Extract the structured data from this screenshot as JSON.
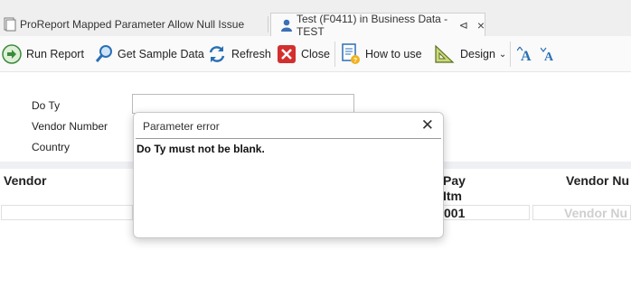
{
  "tabs": [
    {
      "label": "ProReport Mapped Parameter Allow Null Issue",
      "active": false
    },
    {
      "label": "Test (F0411) in Business Data - TEST",
      "active": true
    }
  ],
  "toolbar": {
    "run_report": "Run Report",
    "get_sample_data": "Get Sample Data",
    "refresh": "Refresh",
    "close": "Close",
    "how_to_use": "How to use",
    "design": "Design"
  },
  "form": {
    "do_ty_label": "Do Ty",
    "vendor_number_label": "Vendor Number",
    "country_label": "Country",
    "do_ty_value": ""
  },
  "grid": {
    "headers": [
      "Vendor",
      "Pay",
      "Itm",
      "Vendor Nu"
    ],
    "row": {
      "pay_item": "001",
      "vendor_placeholder": "Vendor Nu"
    }
  },
  "dialog": {
    "title": "Parameter error",
    "message": "Do Ty must not be blank."
  },
  "colors": {
    "accent": "#2e7d32",
    "close_red": "#d32f2f",
    "blue": "#2a6fb5"
  }
}
